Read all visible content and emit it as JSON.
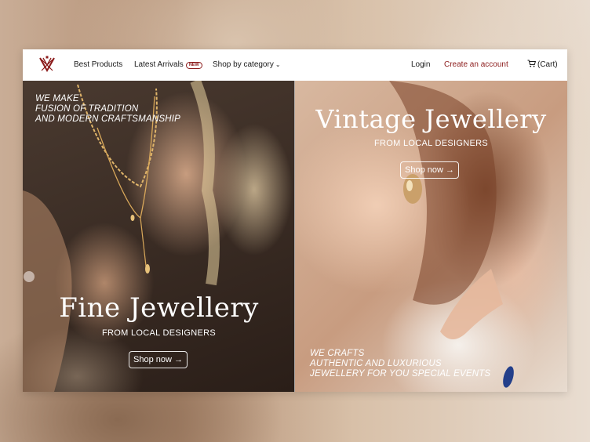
{
  "colors": {
    "accent": "#8b1a1a",
    "nav_bg": "#ffffff",
    "text": "#1a1a1a"
  },
  "nav": {
    "logo": "logo-monogram",
    "best_products": "Best Products",
    "latest_arrivals": "Latest Arrivals",
    "new_badge": "NEW",
    "shop_by_category": "Shop by category",
    "login": "Login",
    "create_account": "Create an account",
    "cart": "(Cart)"
  },
  "left_panel": {
    "tagline": "WE MAKE\nFUSION OF TRADITION\nAND MODERN CRAFTSMANSHIP",
    "headline": "Fine Jewellery",
    "subtitle": "FROM LOCAL DESIGNERS",
    "button": "Shop now"
  },
  "right_panel": {
    "headline": "Vintage Jewellery",
    "subtitle": "FROM LOCAL DESIGNERS",
    "button": "Shop now",
    "tagline": "WE CRAFTS\nAUTHENTIC AND LUXURIOUS\nJEWELLERY FOR YOU SPECIAL EVENTS"
  }
}
